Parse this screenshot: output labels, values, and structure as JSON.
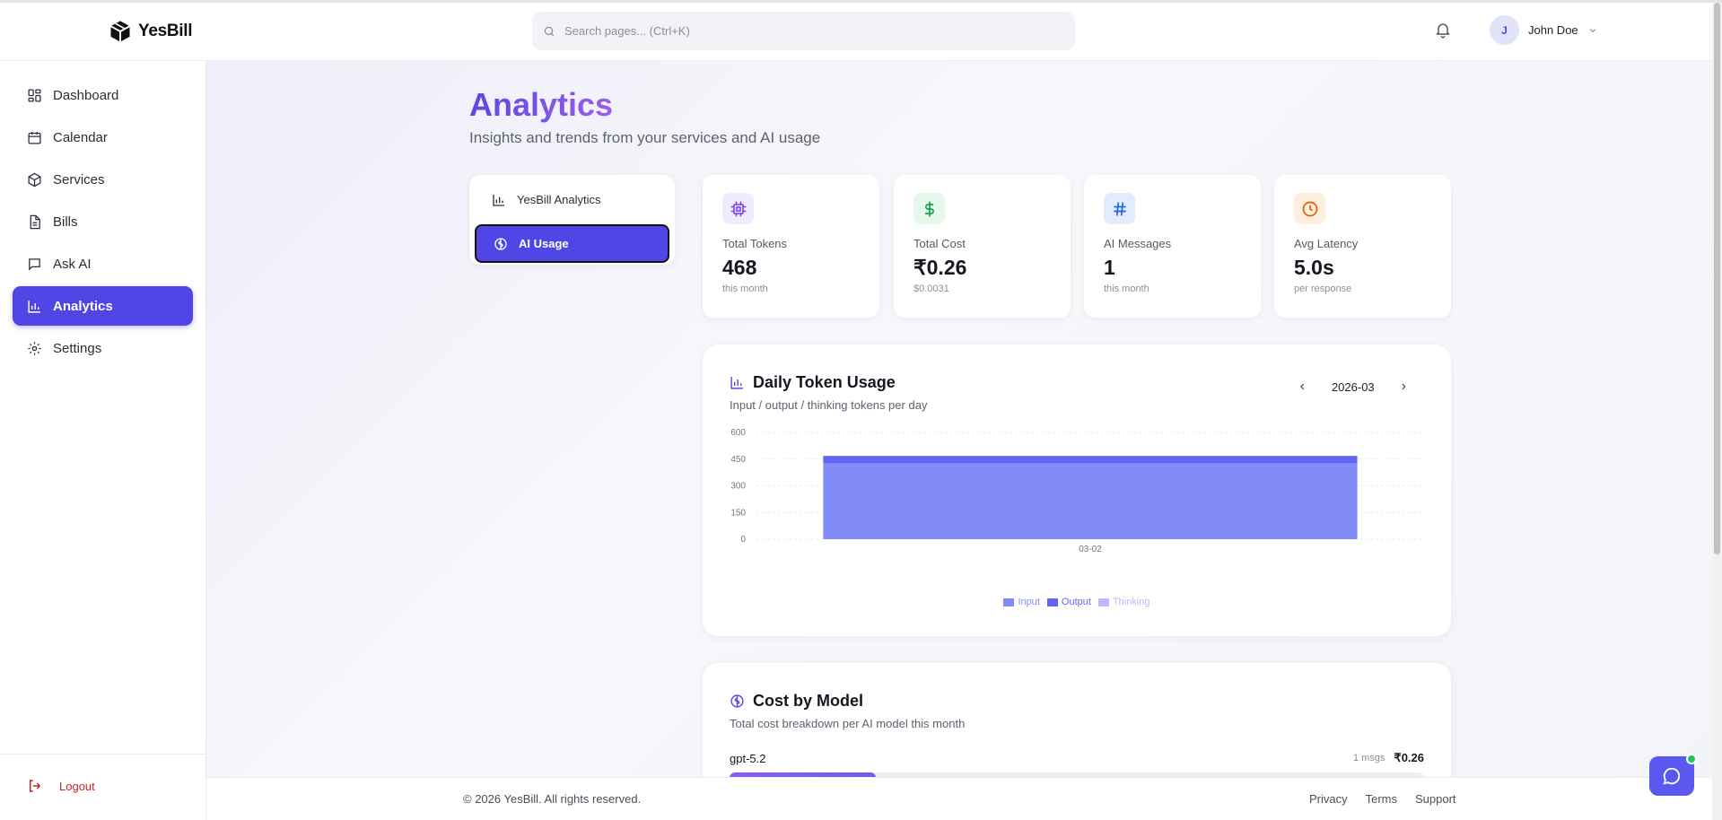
{
  "app": {
    "name": "YesBill"
  },
  "search": {
    "placeholder": "Search pages... (Ctrl+K)"
  },
  "user": {
    "initial": "J",
    "name": "John Doe"
  },
  "sidebar": {
    "items": [
      {
        "label": "Dashboard",
        "icon": "dashboard-icon"
      },
      {
        "label": "Calendar",
        "icon": "calendar-icon"
      },
      {
        "label": "Services",
        "icon": "box-icon"
      },
      {
        "label": "Bills",
        "icon": "file-icon"
      },
      {
        "label": "Ask AI",
        "icon": "message-icon"
      },
      {
        "label": "Analytics",
        "icon": "bar-chart-icon",
        "active": true
      },
      {
        "label": "Settings",
        "icon": "gear-icon"
      }
    ],
    "logout_label": "Logout"
  },
  "page": {
    "title": "Analytics",
    "subtitle": "Insights and trends from your services and AI usage"
  },
  "tabs": [
    {
      "label": "YesBill Analytics",
      "icon": "bar-chart-icon"
    },
    {
      "label": "AI Usage",
      "icon": "brain-icon",
      "active": true
    }
  ],
  "stats": [
    {
      "label": "Total Tokens",
      "value": "468",
      "sub": "this month",
      "icon": "cpu-icon",
      "color": "#7c3aed",
      "bg": "#f1ebfe"
    },
    {
      "label": "Total Cost",
      "value": "₹0.26",
      "sub": "$0.0031",
      "icon": "dollar-icon",
      "color": "#16a34a",
      "bg": "#e6f8ec"
    },
    {
      "label": "AI Messages",
      "value": "1",
      "sub": "this month",
      "icon": "hash-icon",
      "color": "#2563eb",
      "bg": "#e3ecfd"
    },
    {
      "label": "Avg Latency",
      "value": "5.0s",
      "sub": "per response",
      "icon": "clock-icon",
      "color": "#ea580c",
      "bg": "#fdeedd"
    }
  ],
  "daily_usage": {
    "title": "Daily Token Usage",
    "subtitle": "Input / output / thinking tokens per day",
    "month": "2026-03"
  },
  "chart_data": {
    "type": "bar",
    "stacked": true,
    "categories": [
      "03-02"
    ],
    "series": [
      {
        "name": "Input",
        "values": [
          425
        ],
        "color": "#818cf8"
      },
      {
        "name": "Output",
        "values": [
          43
        ],
        "color": "#6366f1"
      },
      {
        "name": "Thinking",
        "values": [
          0
        ],
        "color": "#c4b5fd"
      }
    ],
    "y_ticks": [
      0,
      150,
      300,
      450,
      600
    ],
    "ylim": [
      0,
      600
    ],
    "grid": true,
    "legend": "bottom-center"
  },
  "cost_by_model": {
    "title": "Cost by Model",
    "subtitle": "Total cost breakdown per AI model this month",
    "models": [
      {
        "name": "gpt-5.2",
        "msgs": "1 msgs",
        "cost": "₹0.26",
        "share": 0.21
      }
    ]
  },
  "footer": {
    "copyright": "© 2026 YesBill. All rights reserved.",
    "links": [
      "Privacy",
      "Terms",
      "Support"
    ]
  }
}
